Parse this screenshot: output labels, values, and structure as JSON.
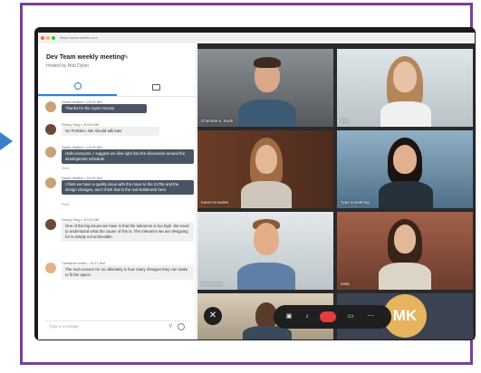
{
  "browser": {
    "url": "https://www.webex.com"
  },
  "meeting": {
    "title": "Dev Team weekly meeting",
    "host": "Hosted by Bob Dylan"
  },
  "chat": {
    "messages": [
      {
        "author_time": "Sarah Walker • 10:00 AM",
        "text": "Thanks for the report Sonny!",
        "style": "dark"
      },
      {
        "author_time": "Sonny King • 10:02 AM",
        "text": "No Problem, We should talk later",
        "style": "light"
      },
      {
        "author_time": "Sarah Walker • 10:00 AM",
        "text": "Hello everyone, I suggest we dive right into the discussion around the development schedule.",
        "style": "dark"
      },
      {
        "author_time": "Sarah Walker • 10:00 AM",
        "text": "I think we have a quality issue with the move to the 2179x and the design changes, and I think that is the real bottleneck here.",
        "style": "dark"
      },
      {
        "author_time": "Sonny King • 10:02 AM",
        "text": "One of the big issues we have is that the tolerance is too high. We need to understand what the cause of this is. The tolerance we are designing for is simply not achievable.",
        "style": "light"
      },
      {
        "author_time": "Christina Lewis • 10:17 AM",
        "text": "The real concern for us ultimately is how many changes they can make to fit the specs.",
        "style": "light"
      }
    ],
    "read_label": "Read",
    "input_placeholder": "Type a message"
  },
  "participants": [
    {
      "name": "Charlotte K. Kush"
    },
    {
      "name": "Toni"
    },
    {
      "name": "Karen Knowles"
    },
    {
      "name": "Type something"
    },
    {
      "name": "Brad Hunter"
    },
    {
      "name": "Sally"
    },
    {
      "name": ""
    },
    {
      "name": ""
    }
  ],
  "self_avatar": {
    "initials": "MK",
    "color": "#e6b35f"
  },
  "controls": {
    "close": "✕"
  },
  "colors": {
    "frame": "#7a3f9a",
    "accent": "#2a7de1",
    "hangup": "#e23c3c"
  }
}
